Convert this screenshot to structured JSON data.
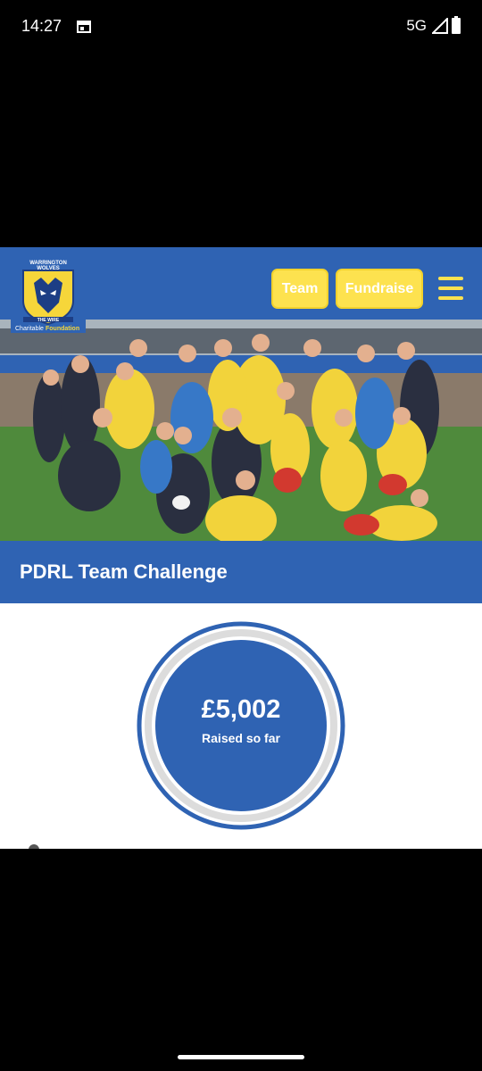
{
  "status_bar": {
    "time": "14:27",
    "network": "5G"
  },
  "header": {
    "logo_text": {
      "line1": "WARRINGTON",
      "line2": "WOLVES",
      "line3": "THE WIRE",
      "line4a": "Charitable",
      "line4b": "Foundation"
    },
    "buttons": {
      "team": "Team",
      "fundraise": "Fundraise"
    }
  },
  "page": {
    "title": "PDRL Team Challenge"
  },
  "fundraising": {
    "amount": "£5,002",
    "label": "Raised so far"
  },
  "colors": {
    "brand_blue": "#2f63b3",
    "brand_yellow": "#fde24f"
  }
}
